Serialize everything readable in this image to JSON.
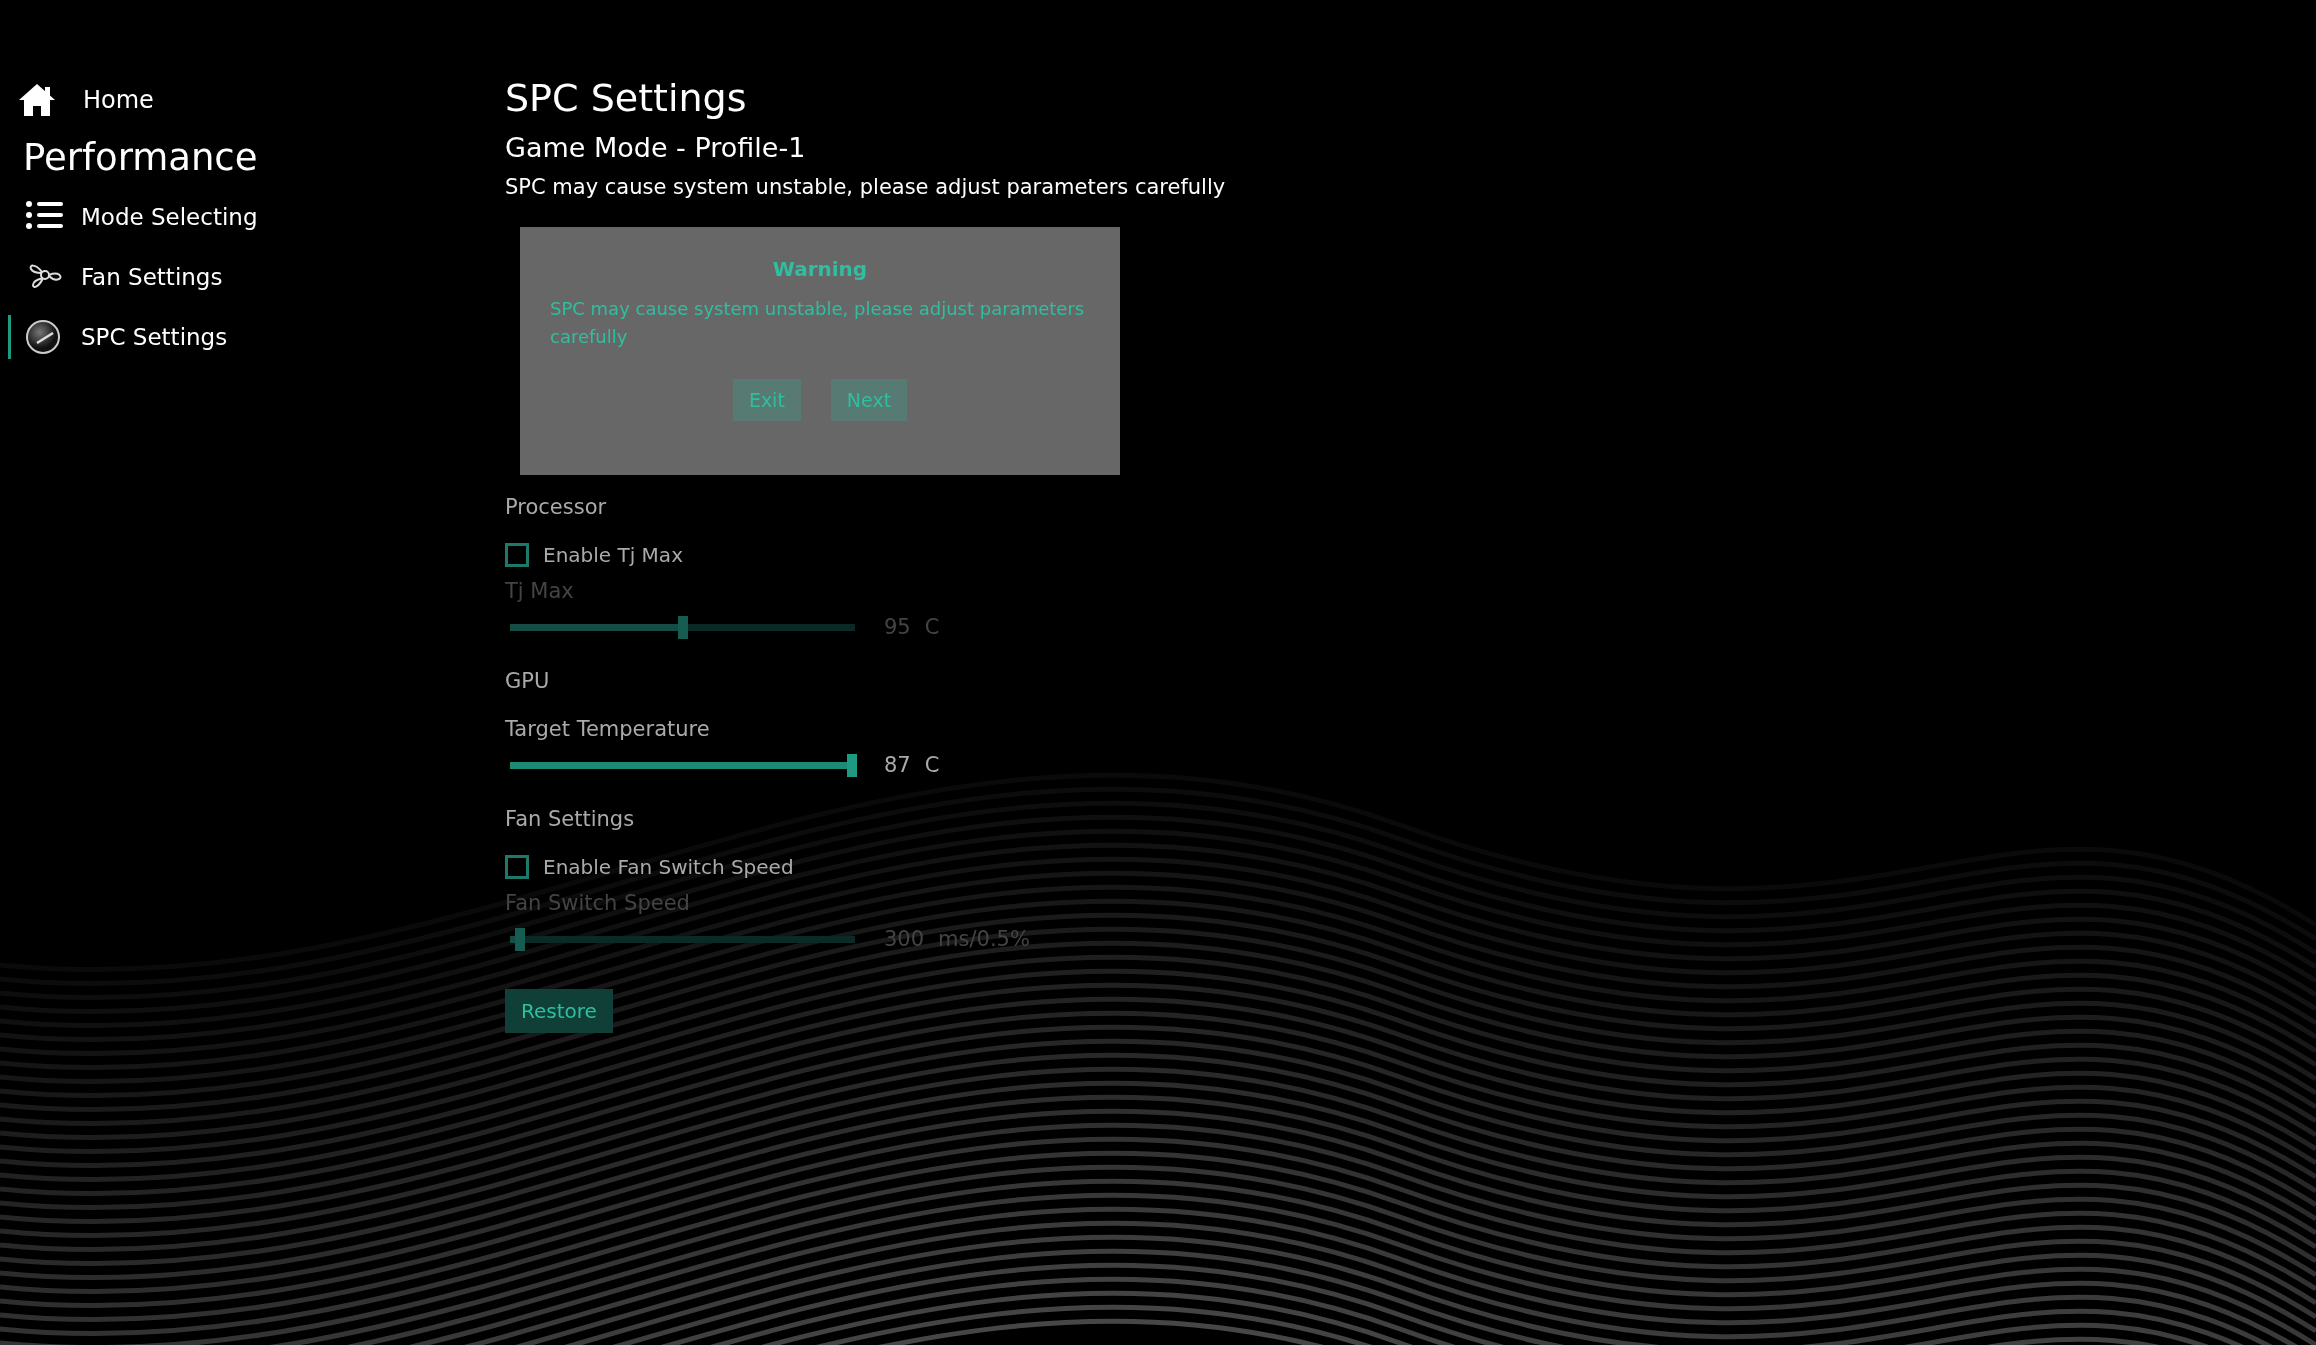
{
  "sidebar": {
    "home": {
      "label": "Home"
    },
    "heading": "Performance",
    "items": [
      {
        "label": "Mode Selecting",
        "kind": "list",
        "selected": false
      },
      {
        "label": "Fan Settings",
        "kind": "fan",
        "selected": false
      },
      {
        "label": "SPC Settings",
        "kind": "gauge",
        "selected": true
      }
    ]
  },
  "page": {
    "title": "SPC Settings",
    "subtitle": "Game Mode - Profile-1",
    "description": "SPC may cause system unstable, please adjust parameters carefully"
  },
  "dialog": {
    "title": "Warning",
    "message": "SPC may cause system unstable, please adjust parameters carefully",
    "buttons": [
      "Exit",
      "Next"
    ]
  },
  "sections": [
    {
      "title": "Processor",
      "controls": [
        {
          "kind": "checkbox",
          "label": "Enable Tj Max",
          "checked": false
        },
        {
          "kind": "slider",
          "label": "Tj Max",
          "disabled": true,
          "level": 0.5,
          "value": "95",
          "unit": "C"
        }
      ]
    },
    {
      "title": "GPU",
      "controls": [
        {
          "kind": "slider",
          "label": "Target Temperature",
          "disabled": false,
          "level": 0.99,
          "value": "87",
          "unit": "C"
        }
      ]
    },
    {
      "title": "Fan Settings",
      "controls": [
        {
          "kind": "checkbox",
          "label": "Enable Fan Switch Speed",
          "checked": false
        },
        {
          "kind": "slider",
          "label": "Fan Switch Speed",
          "disabled": true,
          "level": 0.03,
          "value": "300",
          "unit": "ms/0.5%"
        }
      ]
    }
  ],
  "restore_button": {
    "label": "Restore",
    "disabled": true
  }
}
